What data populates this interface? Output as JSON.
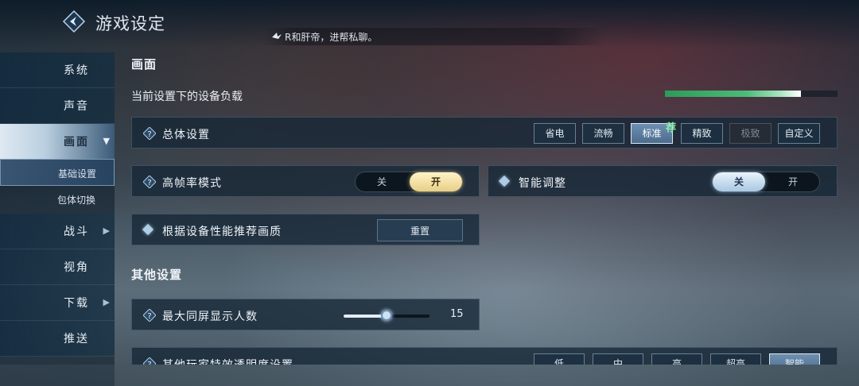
{
  "header": {
    "title": "游戏设定",
    "marquee": "R和肝帝，进帮私聊。"
  },
  "sidebar": {
    "items": [
      {
        "label": "系统"
      },
      {
        "label": "声音"
      },
      {
        "label": "画面"
      },
      {
        "label": "战斗"
      },
      {
        "label": "视角"
      },
      {
        "label": "下载"
      },
      {
        "label": "推送"
      }
    ],
    "sub_items": [
      {
        "label": "基础设置"
      },
      {
        "label": "包体切换"
      }
    ]
  },
  "graphics": {
    "section_title": "画面",
    "load_label": "当前设置下的设备负载",
    "load_fraction": 0.79,
    "overall": {
      "label": "总体设置",
      "options": [
        "省电",
        "流畅",
        "标准",
        "精致",
        "极致",
        "自定义"
      ],
      "selected": "标准",
      "disabled": "极致",
      "recommend_badge": "荐"
    },
    "high_fps": {
      "label": "高帧率模式",
      "off": "关",
      "on": "开",
      "state": "开"
    },
    "smart_adjust": {
      "label": "智能调整",
      "off": "关",
      "on": "开",
      "state": "关"
    },
    "recommend": {
      "label": "根据设备性能推荐画质",
      "button": "重置"
    }
  },
  "other": {
    "section_title": "其他设置",
    "max_players": {
      "label": "最大同屏显示人数",
      "value": "15",
      "slider_fraction": 0.5
    },
    "transparency": {
      "label": "其他玩家特效透明度设置",
      "options": [
        "低",
        "中",
        "高",
        "超高",
        "智能"
      ],
      "selected": "智能"
    }
  },
  "colors": {
    "accent_gold": "#e8cf86",
    "accent_blue": "#a9c8e2",
    "load_green": "#4dbb78",
    "recommend_green": "#8ff0b0"
  }
}
